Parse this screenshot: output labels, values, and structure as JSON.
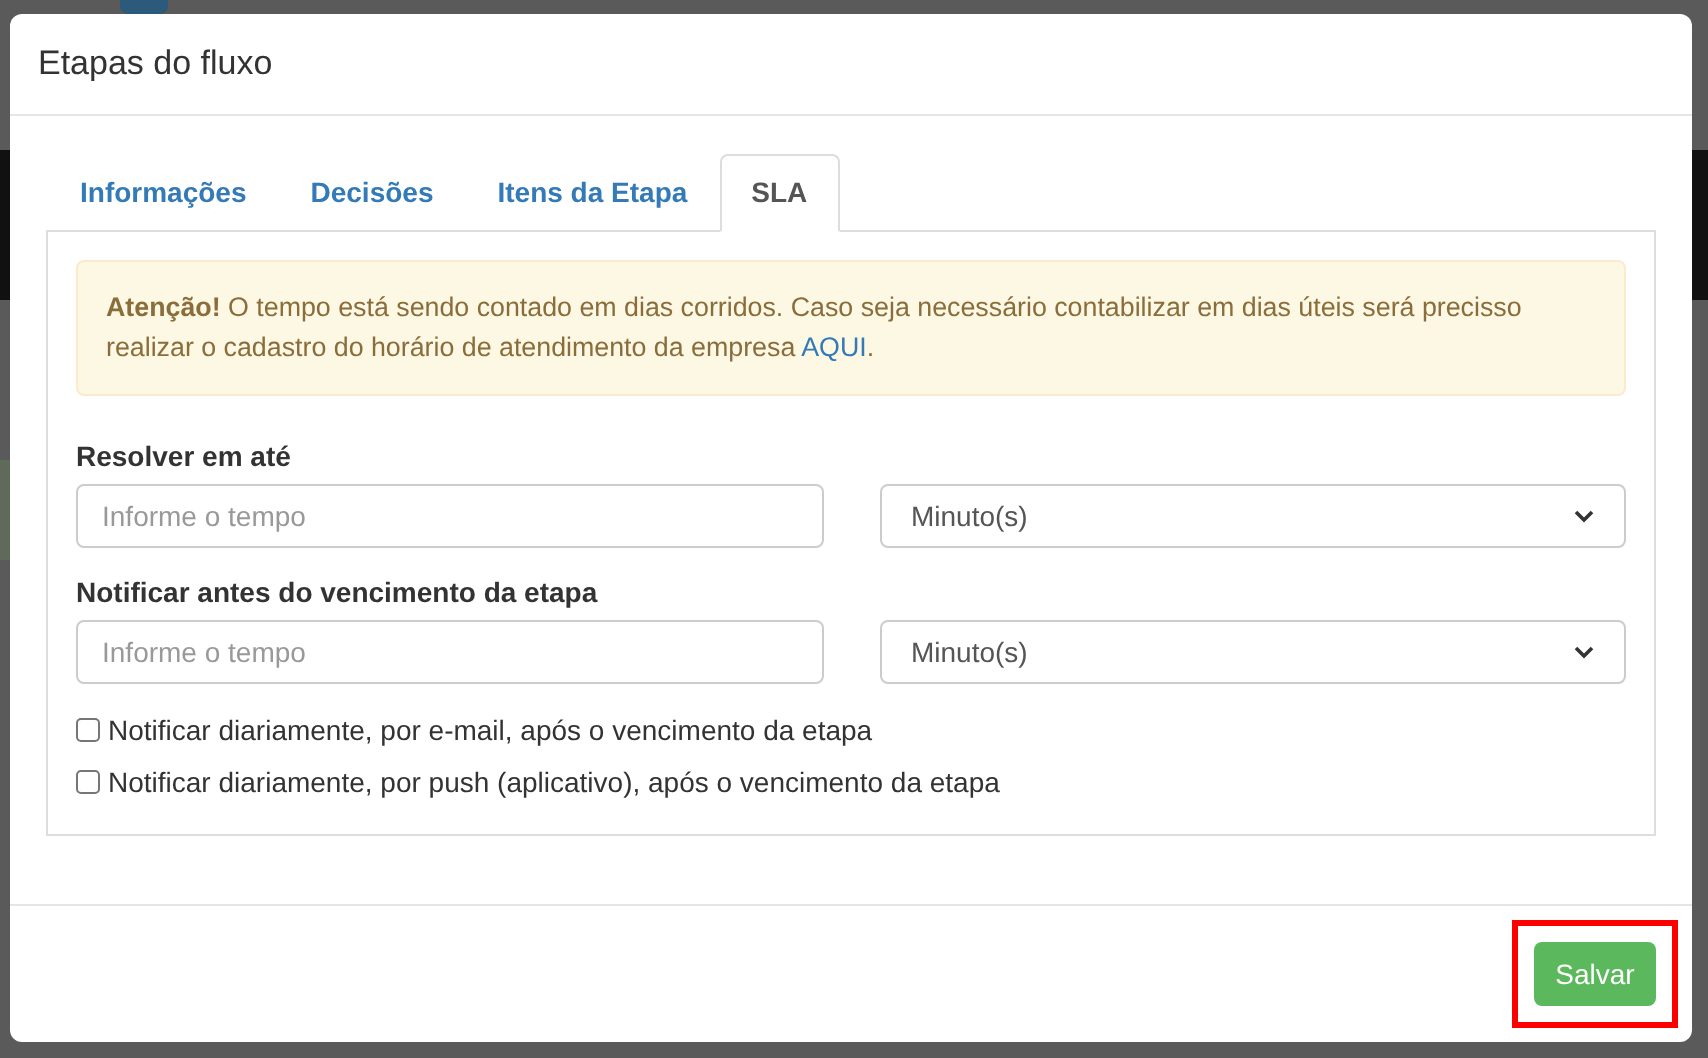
{
  "dialog": {
    "title": "Etapas do fluxo"
  },
  "tabs": [
    {
      "label": "Informações",
      "selected": false
    },
    {
      "label": "Decisões",
      "selected": false
    },
    {
      "label": "Itens da Etapa",
      "selected": false
    },
    {
      "label": "SLA",
      "selected": true
    }
  ],
  "alert": {
    "text": "**Atenção!** O tempo está sendo contado em dias corridos. Caso seja necessário contabilizar em dias úteis será precisso realizar o cadastro do horário de atendimento da empresa ",
    "link": "AQUI",
    "after": "."
  },
  "fields": [
    {
      "label": "Resolver em até",
      "placeholder": "Informe o tempo",
      "unit": "Minuto(s)"
    },
    {
      "label": "Notificar antes do vencimento da etapa",
      "placeholder": "Informe o tempo",
      "unit": "Minuto(s)"
    }
  ],
  "checkboxes": [
    {
      "label": "Notificar diariamente, por e-mail, após o vencimento da etapa",
      "checked": false
    },
    {
      "label": "Notificar diariamente, por push (aplicativo), após o vencimento da etapa",
      "checked": false
    }
  ],
  "save_button": {
    "label": "Salvar",
    "highlighted": true
  }
}
